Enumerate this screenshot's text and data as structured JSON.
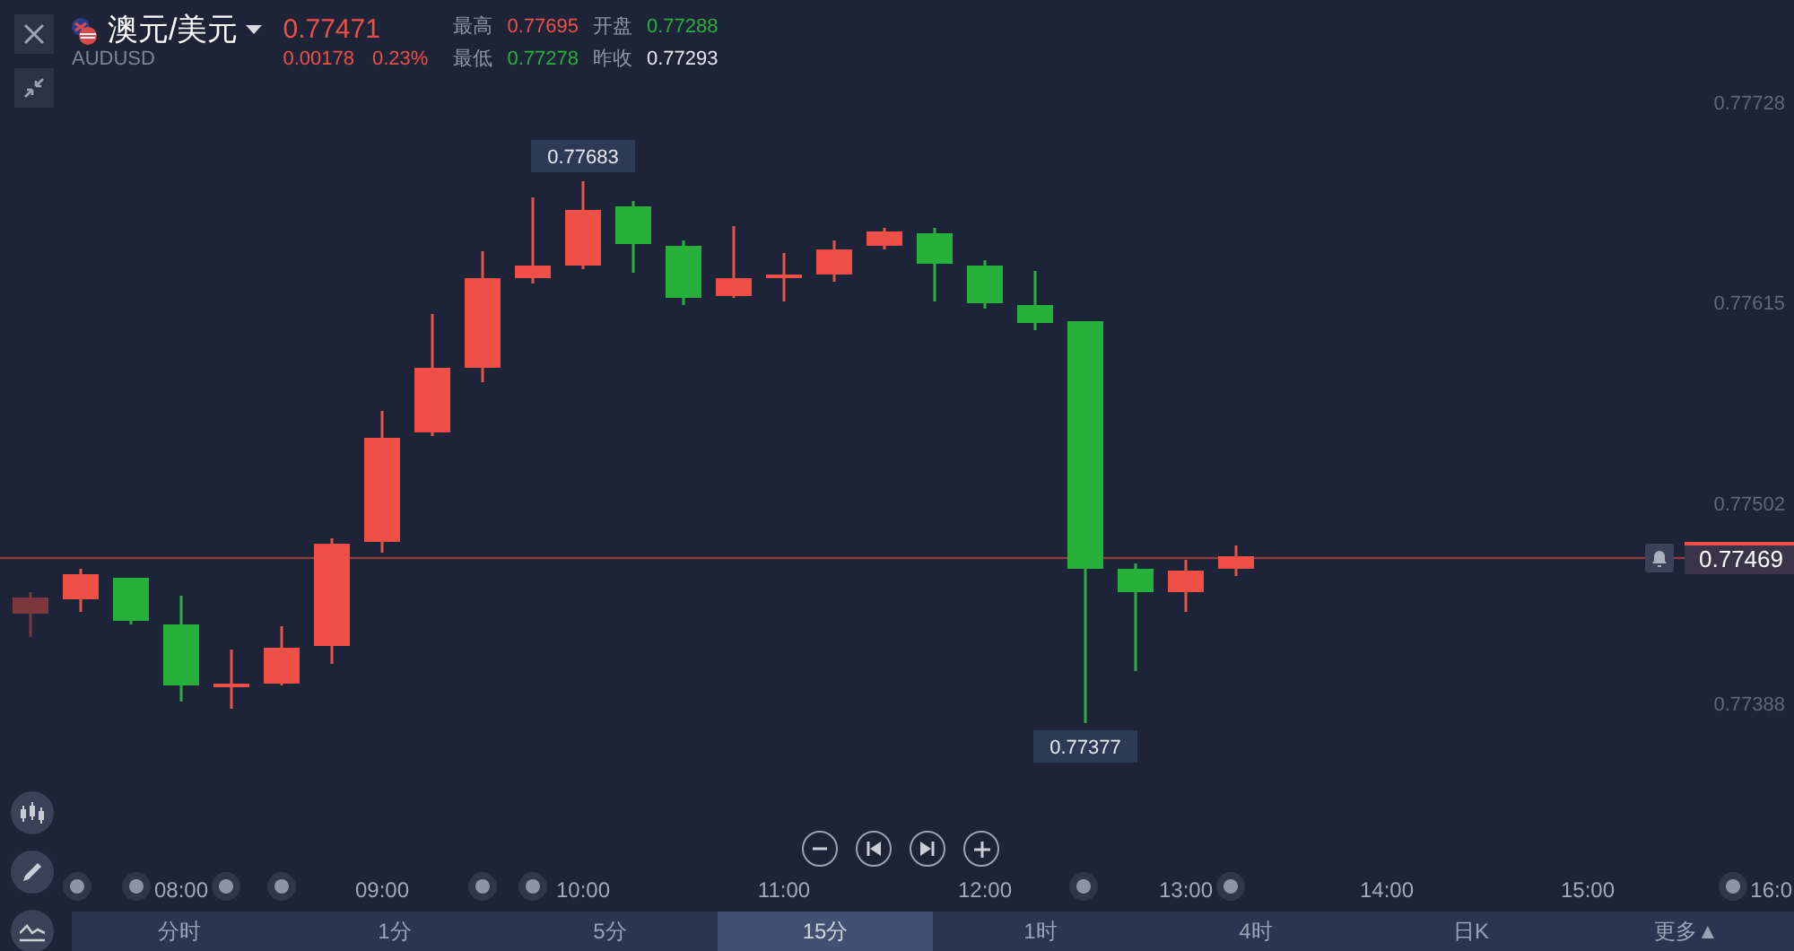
{
  "instrument": {
    "name": "澳元/美元",
    "symbol": "AUDUSD",
    "price": "0.77471",
    "change": "0.00178",
    "change_pct": "0.23%"
  },
  "stats": [
    {
      "label": "最高",
      "value": "0.77695",
      "color": "#ef5046"
    },
    {
      "label": "开盘",
      "value": "0.77288",
      "color": "#27b03a"
    },
    {
      "label": "最低",
      "value": "0.77278",
      "color": "#27b03a"
    },
    {
      "label": "昨收",
      "value": "0.77293",
      "color": "#e6e8ee"
    }
  ],
  "price_axis": [
    "0.77728",
    "0.77615",
    "0.77502",
    "0.77388"
  ],
  "time_axis": [
    "08:00",
    "09:00",
    "10:00",
    "11:00",
    "12:00",
    "13:00",
    "14:00",
    "15:00",
    "16:0"
  ],
  "high_label": "0.77683",
  "low_label": "0.77377",
  "last_price": "0.77469",
  "timeframes": [
    {
      "label": "分时",
      "selected": false
    },
    {
      "label": "1分",
      "selected": false
    },
    {
      "label": "5分",
      "selected": false
    },
    {
      "label": "15分",
      "selected": true
    },
    {
      "label": "1时",
      "selected": false
    },
    {
      "label": "4时",
      "selected": false
    },
    {
      "label": "日K",
      "selected": false
    },
    {
      "label": "更多▲",
      "selected": false
    }
  ]
}
